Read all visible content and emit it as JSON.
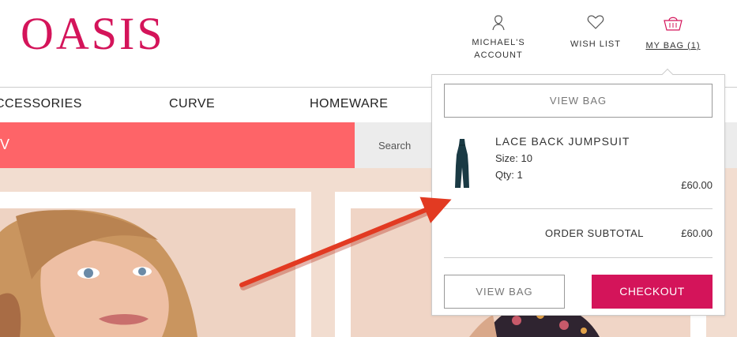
{
  "header": {
    "logo": "OASIS",
    "account_label": "MICHAEL'S ACCOUNT",
    "wishlist_label": "WISH LIST",
    "bag_label": "MY BAG (1)"
  },
  "nav": {
    "items": [
      {
        "label": "CCESSORIES"
      },
      {
        "label": "CURVE"
      },
      {
        "label": "HOMEWARE"
      }
    ]
  },
  "promo": {
    "text": "V"
  },
  "search": {
    "placeholder": "Search"
  },
  "minibag": {
    "view_bag_top": "VIEW BAG",
    "item": {
      "name": "LACE BACK JUMPSUIT",
      "size": "Size: 10",
      "qty": "Qty: 1",
      "price": "£60.00"
    },
    "subtotal_label": "ORDER SUBTOTAL",
    "subtotal_value": "£60.00",
    "view_bag_bottom": "VIEW BAG",
    "checkout": "CHECKOUT"
  },
  "colors": {
    "brand": "#d4145a",
    "promo": "#fe6468",
    "annotation_arrow": "#e23a22"
  },
  "icons": [
    "account-icon",
    "heart-icon",
    "basket-icon"
  ]
}
